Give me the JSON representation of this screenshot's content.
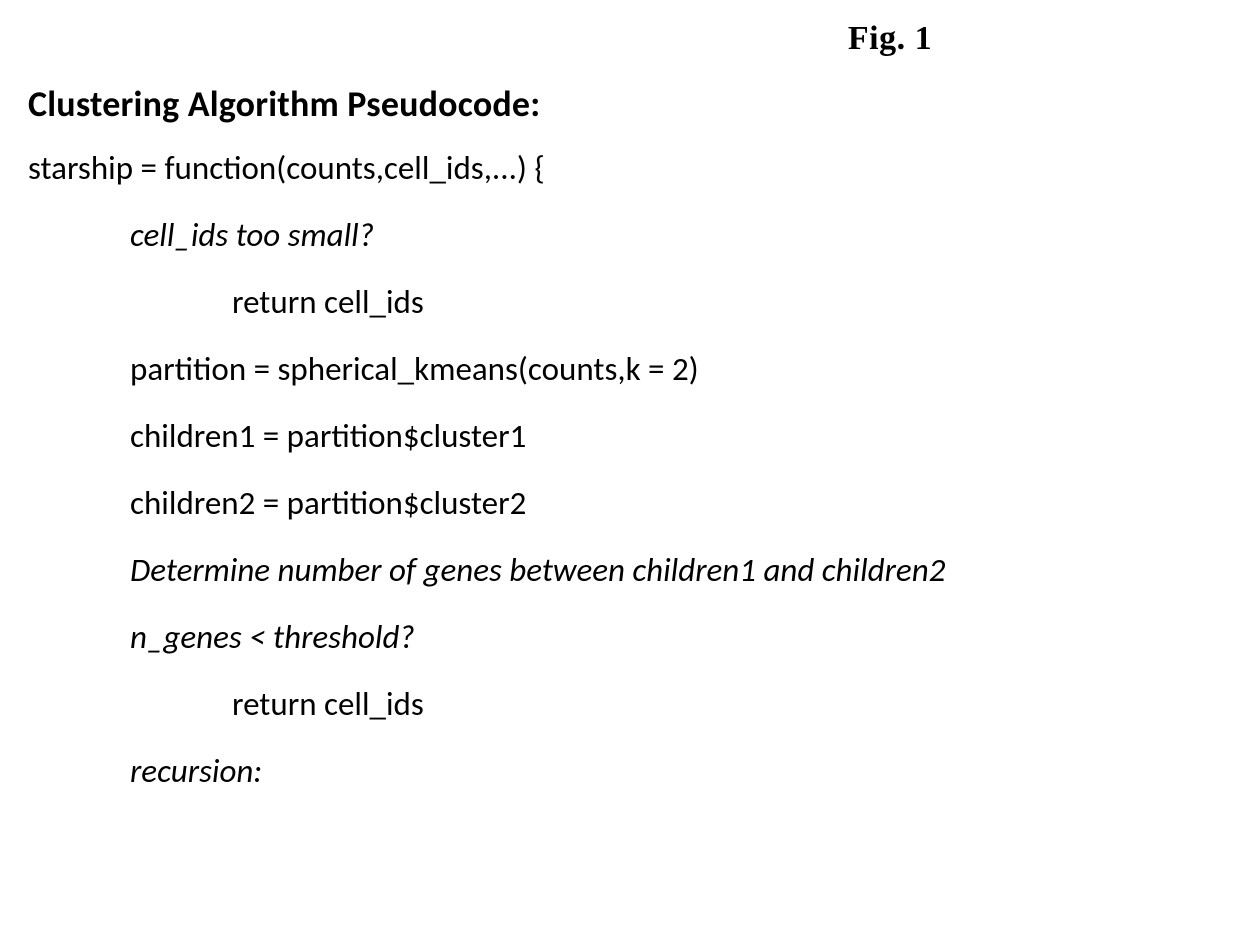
{
  "figure_label": "Fig. 1",
  "heading": "Clustering Algorithm Pseudocode:",
  "lines": {
    "l0": "starship = function(counts,cell_ids,...) {",
    "l1": "cell_ids too small?",
    "l2": "return cell_ids",
    "l3": "partition = spherical_kmeans(counts,k = 2)",
    "l4": "children1 = partition$cluster1",
    "l5": "children2 = partition$cluster2",
    "l6": "Determine number of genes between children1 and children2",
    "l7": "n_genes < threshold?",
    "l8": "return cell_ids",
    "l9": "recursion:"
  }
}
